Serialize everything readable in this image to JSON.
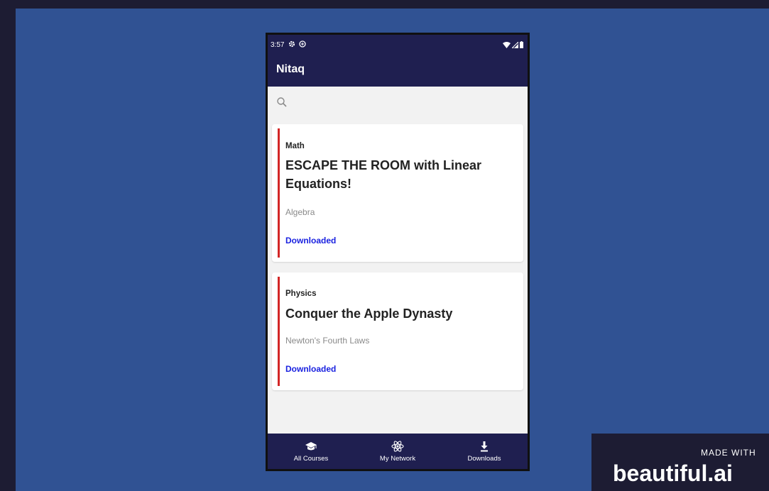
{
  "status_bar": {
    "time": "3:57"
  },
  "app": {
    "title": "Nitaq"
  },
  "search": {
    "placeholder": ""
  },
  "courses": [
    {
      "subject": "Math",
      "title": "ESCAPE THE ROOM with Linear Equations!",
      "topic": "Algebra",
      "status": "Downloaded"
    },
    {
      "subject": "Physics",
      "title": "Conquer the Apple Dynasty",
      "topic": "Newton's Fourth Laws",
      "status": "Downloaded"
    }
  ],
  "bottom_nav": {
    "items": [
      {
        "label": "All Courses",
        "icon": "graduation-cap-icon"
      },
      {
        "label": "My Network",
        "icon": "network-icon"
      },
      {
        "label": "Downloads",
        "icon": "download-icon"
      }
    ]
  },
  "badge": {
    "made_with": "MADE WITH",
    "brand": "beautiful.ai"
  },
  "colors": {
    "slide_background": "#305293",
    "app_bar": "#1f1f50",
    "card_accent": "#d32626",
    "status_text": "#1a22e0"
  }
}
